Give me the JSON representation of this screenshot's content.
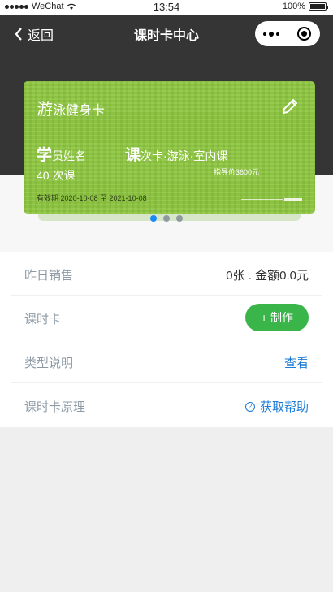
{
  "status_bar": {
    "carrier": "WeChat",
    "time": "13:54",
    "battery": "100%"
  },
  "nav": {
    "back_label": "返回",
    "title": "课时卡中心"
  },
  "card": {
    "name_first": "游",
    "name_rest": "泳健身卡",
    "student_first": "学",
    "student_rest": "员姓名",
    "lessons": "40 次课",
    "type_first": "课",
    "type_rest": "次卡·游泳·室内课",
    "price": "指导价3600元",
    "validity": "有效期 2020-10-08 至 2021-10-08"
  },
  "carousel": {
    "count": 3,
    "active_index": 0
  },
  "list": {
    "yesterday_sales_label": "昨日销售",
    "yesterday_sales_value": "0张 . 金额0.0元",
    "card_label": "课时卡",
    "make_button": "+ 制作",
    "type_label": "类型说明",
    "type_link": "查看",
    "principle_label": "课时卡原理",
    "principle_link": "获取帮助"
  },
  "colors": {
    "nav_bg": "#353535",
    "card_green": "#8dc63f",
    "make_button_green": "#39b54a",
    "link_blue": "#1a7ad6",
    "active_dot": "#1989fa"
  }
}
